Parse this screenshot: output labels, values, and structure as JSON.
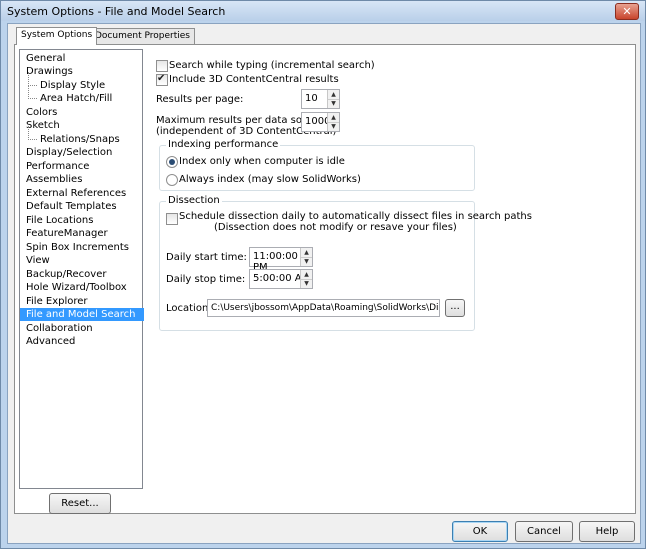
{
  "window": {
    "title": "System Options - File and Model Search",
    "close_glyph": "✕"
  },
  "tabs": [
    {
      "label": "System Options"
    },
    {
      "label": "Document Properties"
    }
  ],
  "nav": {
    "items": [
      {
        "label": "General"
      },
      {
        "label": "Drawings"
      },
      {
        "label": "Display Style"
      },
      {
        "label": "Area Hatch/Fill"
      },
      {
        "label": "Colors"
      },
      {
        "label": "Sketch"
      },
      {
        "label": "Relations/Snaps"
      },
      {
        "label": "Display/Selection"
      },
      {
        "label": "Performance"
      },
      {
        "label": "Assemblies"
      },
      {
        "label": "External References"
      },
      {
        "label": "Default Templates"
      },
      {
        "label": "File Locations"
      },
      {
        "label": "FeatureManager"
      },
      {
        "label": "Spin Box Increments"
      },
      {
        "label": "View"
      },
      {
        "label": "Backup/Recover"
      },
      {
        "label": "Hole Wizard/Toolbox"
      },
      {
        "label": "File Explorer"
      },
      {
        "label": "File and Model Search"
      },
      {
        "label": "Collaboration"
      },
      {
        "label": "Advanced"
      }
    ],
    "reset_label": "Reset..."
  },
  "options": {
    "search_while_typing": "Search while typing (incremental search)",
    "include_3dcc": "Include 3D ContentCentral results",
    "results_per_page_label": "Results per page:",
    "results_per_page_value": "10",
    "max_results_label_1": "Maximum results per data source:",
    "max_results_label_2": "(independent of 3D ContentCentral)",
    "max_results_value": "1000"
  },
  "indexing": {
    "title": "Indexing performance",
    "option_idle": "Index only when computer is idle",
    "option_always": "Always index (may slow SolidWorks)"
  },
  "dissection": {
    "title": "Dissection",
    "schedule_label_1": "Schedule dissection daily to automatically dissect files in search paths",
    "schedule_label_2": "(Dissection does not modify or resave your files)",
    "start_label": "Daily start time:",
    "start_value": "11:00:00 PM",
    "stop_label": "Daily stop time:",
    "stop_value": "5:00:00 AM",
    "location_label": "Location:",
    "location_value": "C:\\Users\\jbossom\\AppData\\Roaming\\SolidWorks\\Dissection",
    "browse_label": "..."
  },
  "footer": {
    "ok": "OK",
    "cancel": "Cancel",
    "help": "Help"
  },
  "arrows": {
    "up": "▲",
    "down": "▼"
  }
}
